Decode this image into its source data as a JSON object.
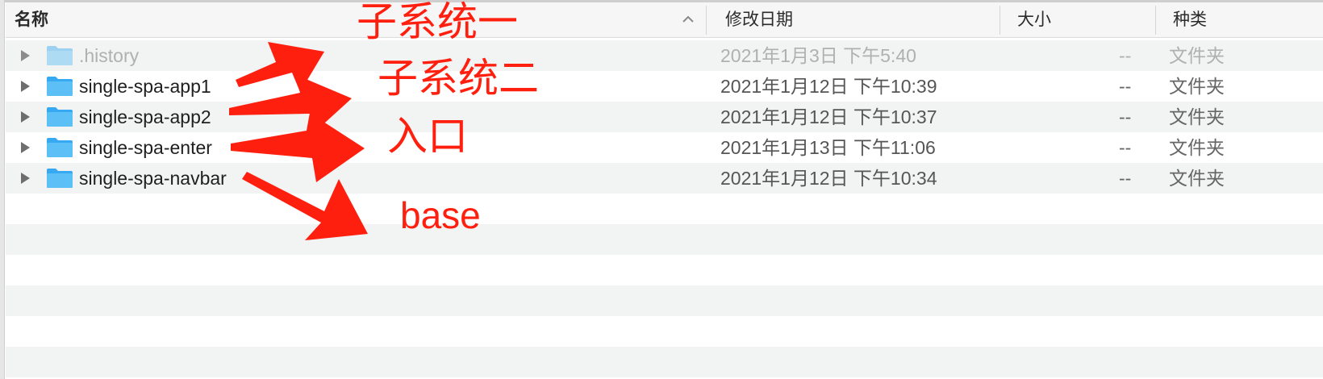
{
  "header": {
    "name": "名称",
    "date": "修改日期",
    "size": "大小",
    "kind": "种类"
  },
  "rows": [
    {
      "name": ".history",
      "date": "2021年1月3日 下午5:40",
      "size": "--",
      "kind": "文件夹",
      "dimmed": true
    },
    {
      "name": "single-spa-app1",
      "date": "2021年1月12日 下午10:39",
      "size": "--",
      "kind": "文件夹",
      "dimmed": false
    },
    {
      "name": "single-spa-app2",
      "date": "2021年1月12日 下午10:37",
      "size": "--",
      "kind": "文件夹",
      "dimmed": false
    },
    {
      "name": "single-spa-enter",
      "date": "2021年1月13日 下午11:06",
      "size": "--",
      "kind": "文件夹",
      "dimmed": false
    },
    {
      "name": "single-spa-navbar",
      "date": "2021年1月12日 下午10:34",
      "size": "--",
      "kind": "文件夹",
      "dimmed": false
    }
  ],
  "annotations": {
    "app1": "子系统一",
    "app2": "子系统二",
    "enter": "入口",
    "navbar": "base"
  },
  "icons": {
    "disclosure": "disclosure-triangle-icon",
    "folder": "folder-icon",
    "sort": "sort-ascending-icon"
  },
  "colors": {
    "annotation": "#ff1f0f",
    "folder": "#37a9f2",
    "row_alt": "#f2f3f3"
  }
}
